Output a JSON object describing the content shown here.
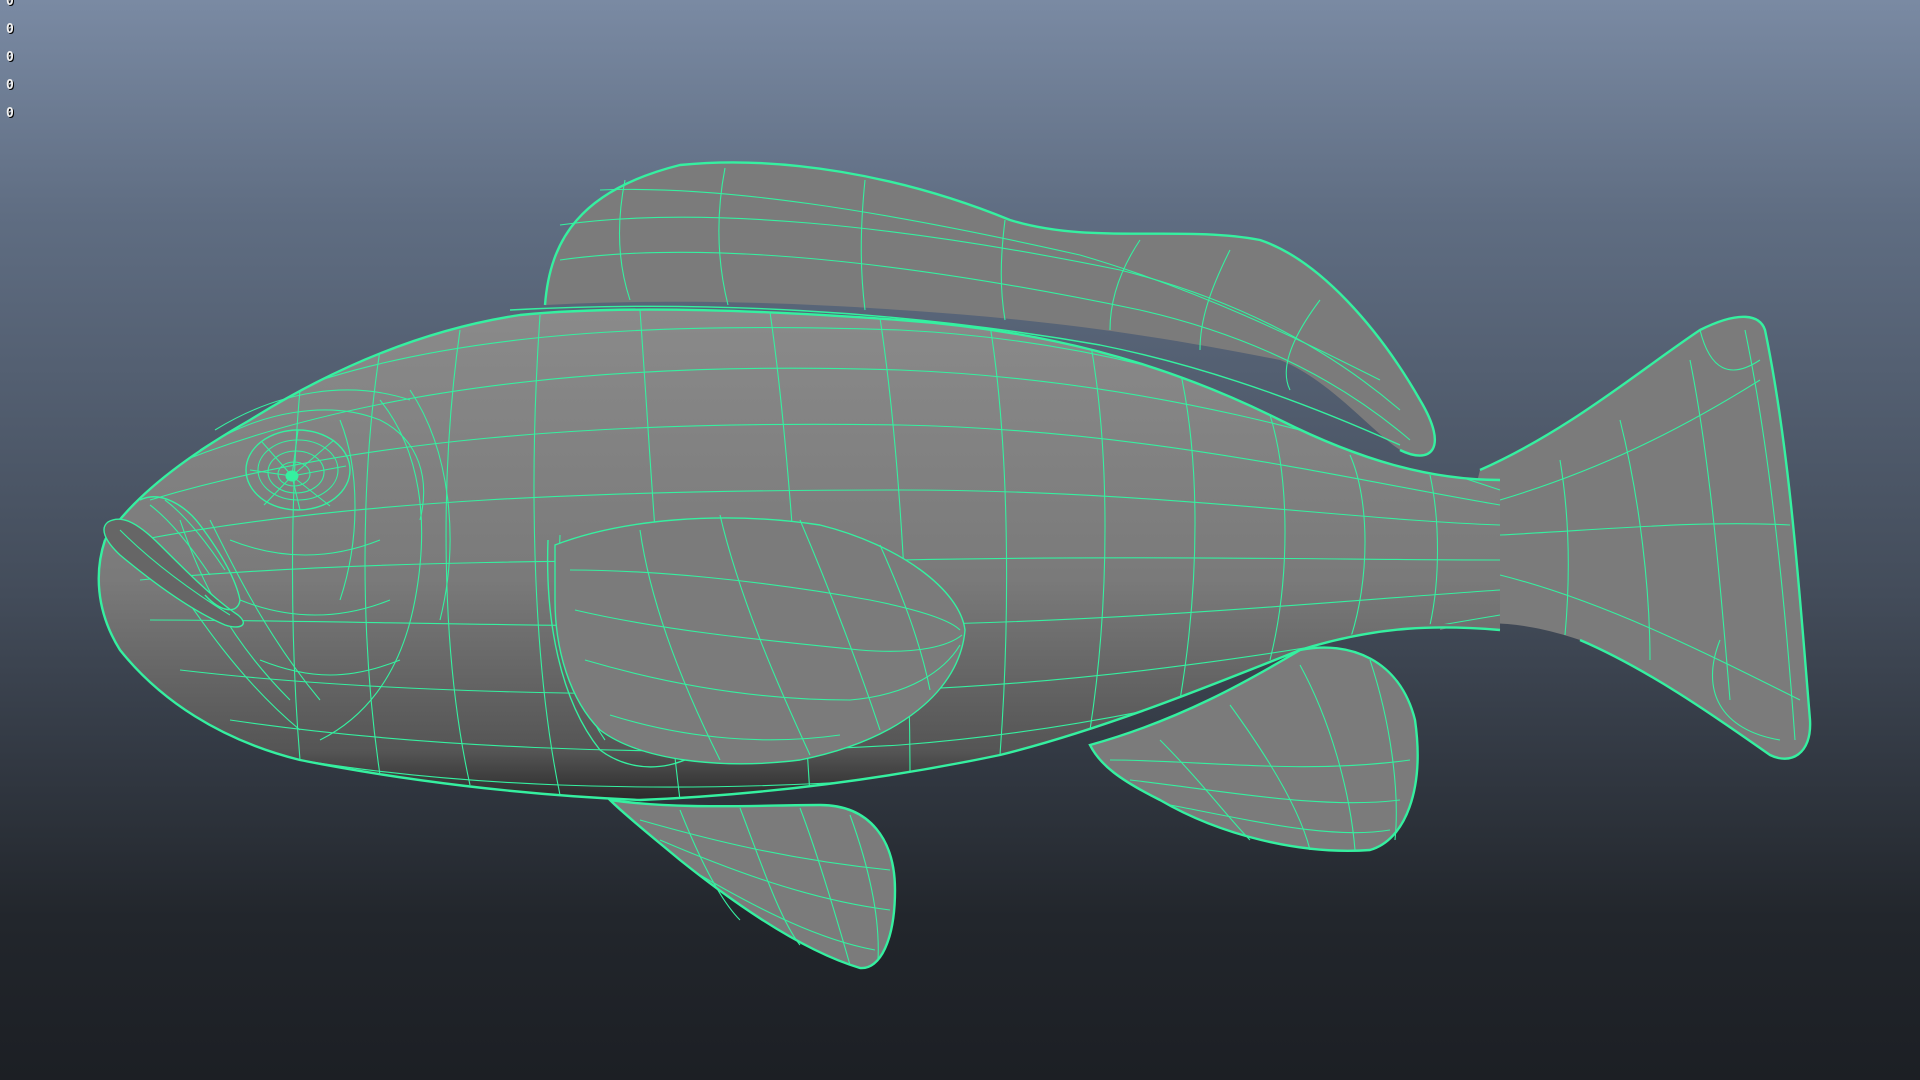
{
  "viewport": {
    "hud_values": [
      "0",
      "0",
      "0",
      "0",
      "0"
    ],
    "wireframe_color": "#35f0a0",
    "surface_color": "#7b7b7b",
    "background_top": "#7a8aa3",
    "background_bottom": "#1c1f24",
    "model": "fish"
  }
}
